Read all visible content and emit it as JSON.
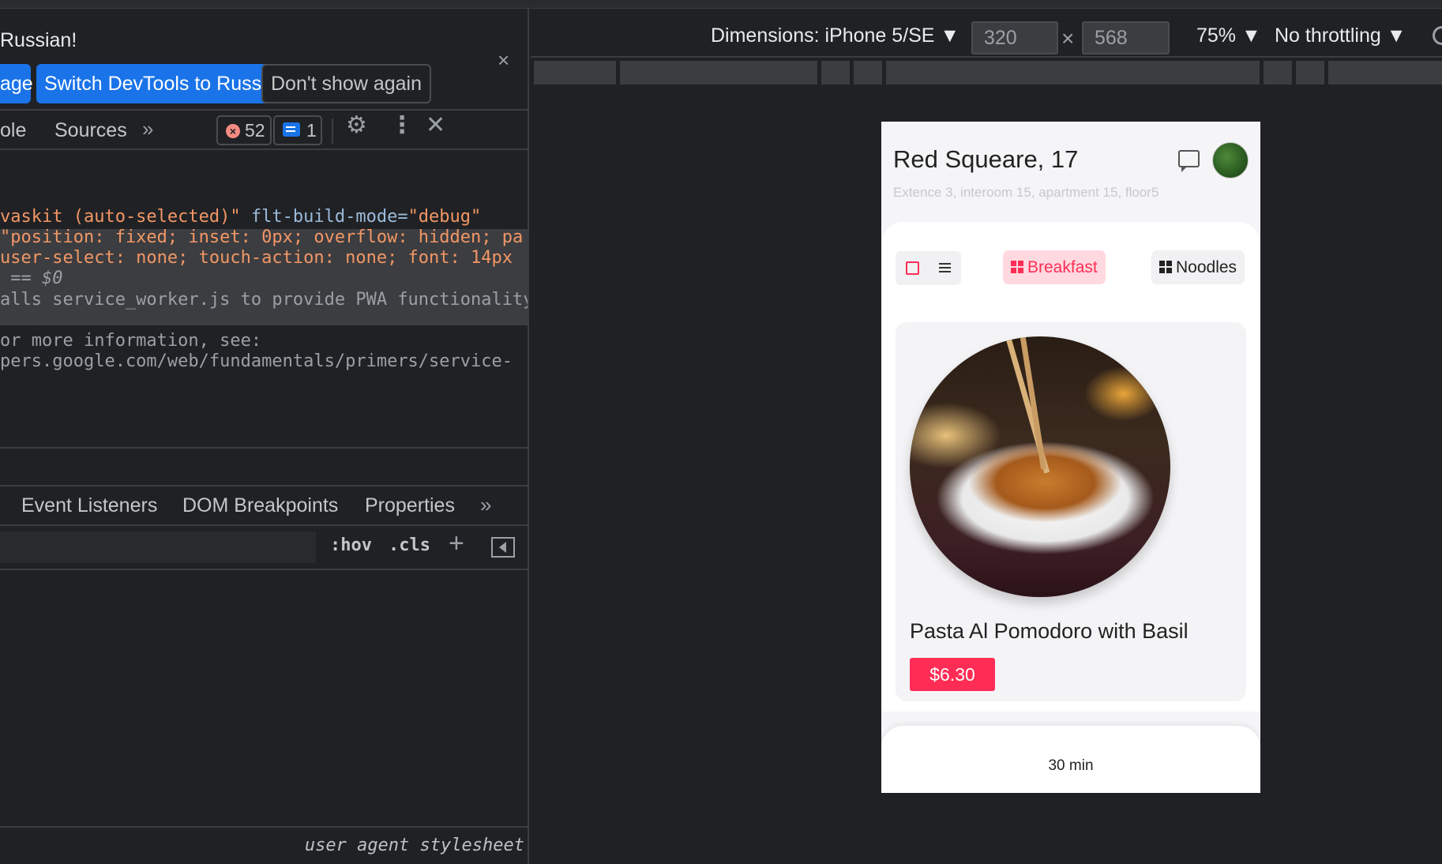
{
  "infobar": {
    "message": "Russian!",
    "btn_partial": "age",
    "btn_switch": "Switch DevTools to Russian",
    "btn_dont_show": "Don't show again",
    "close": "×"
  },
  "tabs": {
    "console_partial": "ole",
    "sources": "Sources",
    "more": "»",
    "errors_count": "52",
    "messages_count": "1"
  },
  "code": {
    "line1_a": "vaskit (auto-selected)\"",
    "line1_b": " flt-build-mode=",
    "line1_c": "\"debug\"",
    "line2": "\"position: fixed; inset: 0px; overflow: hidden; pa",
    "line3": "user-select: none; touch-action: none; font: 14px",
    "line4": " == $0",
    "line5": "alls service_worker.js to provide PWA functionality",
    "line6": "or more information, see:",
    "line7": "pers.google.com/web/fundamentals/primers/service-"
  },
  "subtabs": {
    "event_listeners": "Event Listeners",
    "dom_breakpoints": "DOM Breakpoints",
    "properties": "Properties",
    "more": "»"
  },
  "filterbar": {
    "hov": ":hov",
    "cls": ".cls"
  },
  "bottom": {
    "ua_stylesheet": "user agent stylesheet"
  },
  "device_toolbar": {
    "dimensions_label": "Dimensions: iPhone 5/SE ▼",
    "width": "320",
    "height": "568",
    "times": "×",
    "zoom": "75% ▼",
    "throttling": "No throttling ▼"
  },
  "app": {
    "address_title": "Red Squeare, 17",
    "address_sub": "Extence 3, interoom 15, apartment 15, floor5",
    "chip_breakfast": "Breakfast",
    "chip_noodles": "Noodles",
    "dish_name": "Pasta Al Pomodoro with Basil",
    "price": "$6.30",
    "time": "30 min"
  },
  "colors": {
    "accent": "#ff2d55",
    "devtools_bg": "#202124",
    "primary_button": "#1a73e8"
  }
}
